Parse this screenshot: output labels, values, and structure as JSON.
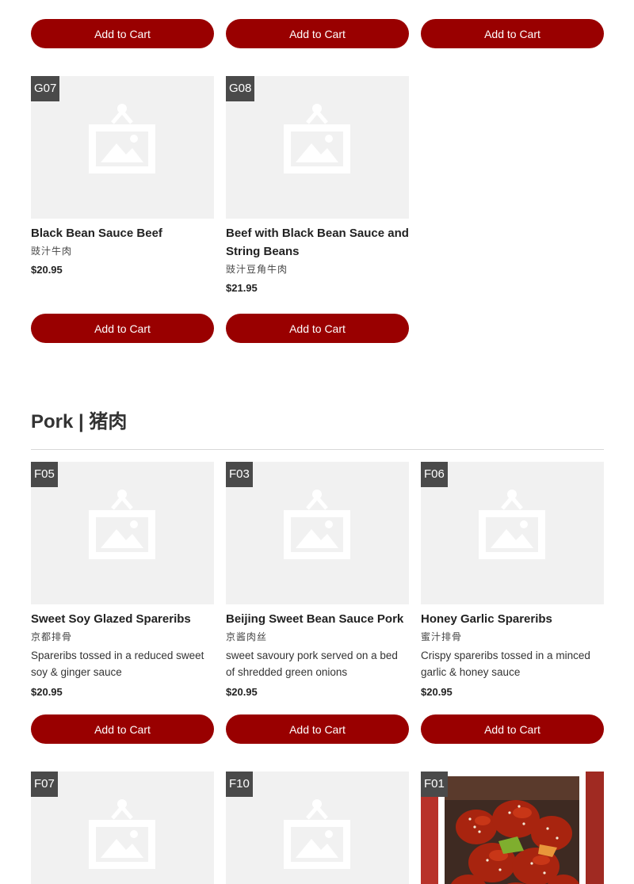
{
  "add_to_cart_label": "Add to Cart",
  "section": {
    "title": "Pork | 猪肉"
  },
  "beef_items": [
    {
      "code": "G07",
      "name": "Black Bean Sauce Beef",
      "cn": "豉汁牛肉",
      "price": "$20.95"
    },
    {
      "code": "G08",
      "name": "Beef with Black Bean Sauce and String Beans",
      "cn": "豉汁豆角牛肉",
      "price": "$21.95"
    }
  ],
  "pork_items": [
    {
      "code": "F05",
      "name": "Sweet Soy Glazed Spareribs",
      "cn": "京都排骨",
      "desc": "Spareribs tossed in a reduced sweet soy & ginger sauce",
      "price": "$20.95"
    },
    {
      "code": "F03",
      "name": "Beijing Sweet Bean Sauce Pork",
      "cn": "京酱肉丝",
      "desc": "sweet savoury pork served on a bed of shredded green onions",
      "price": "$20.95"
    },
    {
      "code": "F06",
      "name": "Honey Garlic Spareribs",
      "cn": "蜜汁排骨",
      "desc": "Crispy spareribs tossed in a minced garlic & honey sauce",
      "price": "$20.95"
    }
  ],
  "bottom_items": [
    {
      "code": "F07"
    },
    {
      "code": "F10"
    },
    {
      "code": "F01"
    }
  ],
  "colors": {
    "accent": "#990000",
    "badge": "#4a4a4a",
    "placeholder_bg": "#f1f1f1"
  },
  "icons": {
    "placeholder": "image-placeholder-icon"
  }
}
